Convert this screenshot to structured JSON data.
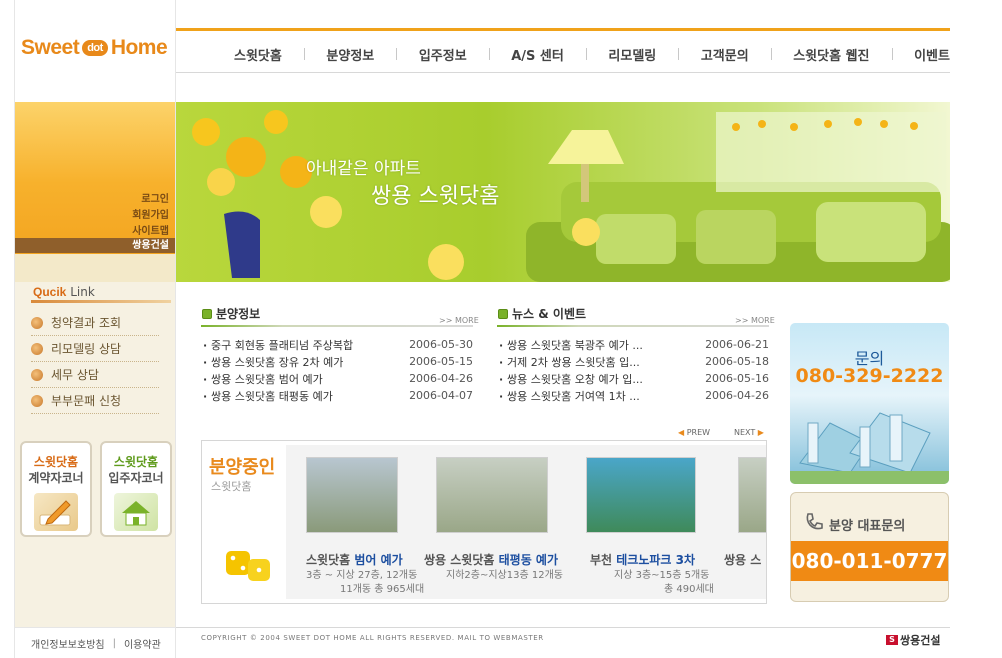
{
  "brand": {
    "logo_left": "Sweet",
    "logo_mid": "dot",
    "logo_right": "Home"
  },
  "nav": {
    "items": [
      "스윗닷홈",
      "분양정보",
      "입주정보",
      "A/S 센터",
      "리모델링",
      "고객문의",
      "스윗닷홈 웹진",
      "이벤트"
    ]
  },
  "util": {
    "login": "로그인",
    "join": "회원가입",
    "sitemap": "사이트맵",
    "company": "쌍용건설"
  },
  "hero": {
    "line1": "아내같은 아파트",
    "line2": "쌍용 스윗닷홈"
  },
  "quick": {
    "title_a": "Qucik",
    "title_b": "Link",
    "items": [
      "청약결과 조회",
      "리모델링 상담",
      "세무 상담",
      "부부문패 신청"
    ]
  },
  "corners": [
    {
      "line1": "스윗닷홈",
      "line2": "계약자코너"
    },
    {
      "line1": "스윗닷홈",
      "line2": "입주자코너"
    }
  ],
  "presale_info": {
    "title": "분양정보",
    "more": ">> MORE",
    "rows": [
      {
        "text": "중구 회현동 플래티넘 주상복합",
        "date": "2006-05-30"
      },
      {
        "text": "쌍용 스윗닷홈 장유 2차 예가",
        "date": "2006-05-15"
      },
      {
        "text": "쌍용 스윗닷홈 범어 예가",
        "date": "2006-04-26"
      },
      {
        "text": "쌍용 스윗닷홈 태평동 예가",
        "date": "2006-04-07"
      }
    ]
  },
  "news": {
    "title": "뉴스 & 이벤트",
    "more": ">> MORE",
    "rows": [
      {
        "text": "쌍용 스윗닷홈 북광주 예가 ...",
        "date": "2006-06-21"
      },
      {
        "text": "거제 2차 쌍용 스윗닷홈 입...",
        "date": "2006-05-18"
      },
      {
        "text": "쌍용 스윗닷홈 오창 예가 입...",
        "date": "2006-05-16"
      },
      {
        "text": "쌍용 스윗닷홈 거여역 1차 ...",
        "date": "2006-04-26"
      }
    ]
  },
  "carousel": {
    "prev": "PREW",
    "next": "NEXT"
  },
  "presale_strip": {
    "title": "분양중인",
    "sub": "스윗닷홈",
    "items": [
      {
        "pre": "스윗닷홈 ",
        "hi": "범어 예가",
        "det1": "3층 ~ 지상 27층, 12개동",
        "det2": "11개동 총 965세대"
      },
      {
        "pre": "쌍용 스윗닷홈 ",
        "hi": "태평동 예가",
        "det1": "지하2층~지상13층 12개동",
        "det2": ""
      },
      {
        "pre": "부천 ",
        "hi": "테크노파크 3차",
        "det1": "지상 3층~15층 5개동",
        "det2": "총 490세대"
      },
      {
        "pre": "쌍용 스",
        "hi": "",
        "det1": "",
        "det2": ""
      }
    ]
  },
  "contact1": {
    "label": "문의",
    "phone": "080-329-2222"
  },
  "contact2": {
    "label": "분양 대표문의",
    "phone": "080-011-0777"
  },
  "footer": {
    "privacy": "개인정보보호방침",
    "sep": "|",
    "terms": "이용약관",
    "copyright": "COPYRIGHT © 2004 SWEET DOT HOME ALL RIGHTS RESERVED. MAIL TO WEBMASTER",
    "company": "쌍용건설"
  },
  "colors": {
    "accent": "#f0a21a",
    "brand_orange": "#e8891a",
    "green": "#7ab22a",
    "phone_orange": "#f08a14"
  }
}
